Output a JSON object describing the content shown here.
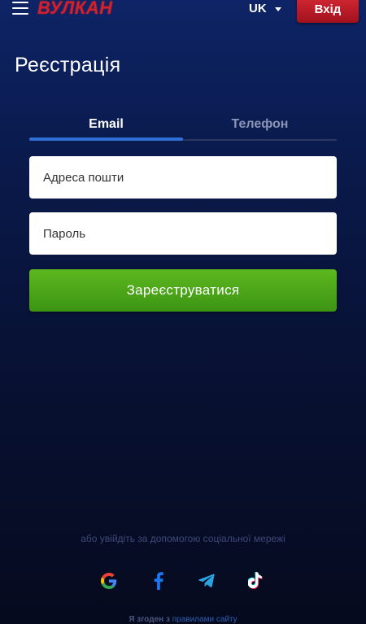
{
  "header": {
    "logo_text": "ВУЛКАН",
    "language": "UK",
    "login_label": "Вхід",
    "brand_color": "#d4202a"
  },
  "page": {
    "title": "Реєстрація"
  },
  "tabs": [
    {
      "label": "Email",
      "active": true
    },
    {
      "label": "Телефон",
      "active": false
    }
  ],
  "form": {
    "email_placeholder": "Адреса пошти",
    "email_value": "",
    "password_placeholder": "Пароль",
    "password_value": "",
    "submit_label": "Зареєструватися"
  },
  "social": {
    "caption": "або увійдіть за допомогою соціальної мережі",
    "icons": [
      "google-icon",
      "facebook-icon",
      "telegram-icon",
      "tiktok-icon"
    ]
  },
  "footer": {
    "consent_prefix": "Я згоден з",
    "consent_link": "правилами сайту"
  },
  "colors": {
    "accent_blue": "#2f6fd6",
    "submit_green": "#4ca819",
    "login_red": "#b81a25"
  }
}
